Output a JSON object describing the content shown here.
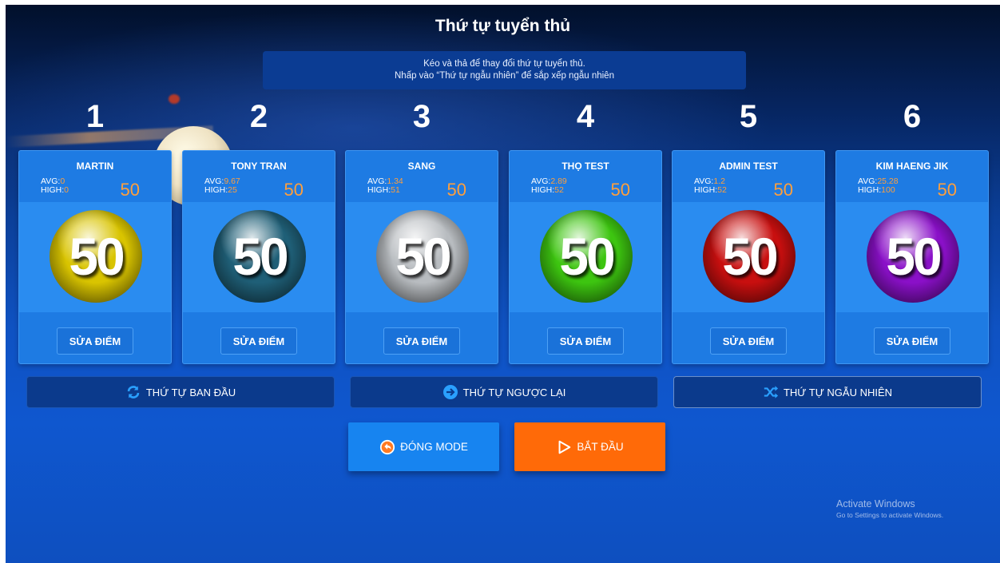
{
  "title": "Thứ tự tuyển thủ",
  "instructions": {
    "line1": "Kéo và thả để thay đổi thứ tự tuyển thủ.",
    "line2": "Nhấp vào “Thứ tự ngẫu nhiên” để sắp xếp ngẫu nhiên"
  },
  "players": [
    {
      "order": "1",
      "name": "MARTIN",
      "avg_label": "AVG:",
      "avg": "0",
      "high_label": "HIGH:",
      "high": "0",
      "score": "50",
      "ball_number": "50",
      "ball_color": "#d9c400",
      "edit_label": "SỬA ĐIỂM"
    },
    {
      "order": "2",
      "name": "TONY TRAN",
      "avg_label": "AVG:",
      "avg": "9.67",
      "high_label": "HIGH:",
      "high": "25",
      "score": "50",
      "ball_number": "50",
      "ball_color": "#1f5f77",
      "edit_label": "SỬA ĐIỂM"
    },
    {
      "order": "3",
      "name": "SANG",
      "avg_label": "AVG:",
      "avg": "1.34",
      "high_label": "HIGH:",
      "high": "51",
      "score": "50",
      "ball_number": "50",
      "ball_color": "#b8bcc0",
      "edit_label": "SỬA ĐIỂM"
    },
    {
      "order": "4",
      "name": "THỌ TEST",
      "avg_label": "AVG:",
      "avg": "2.89",
      "high_label": "HIGH:",
      "high": "52",
      "score": "50",
      "ball_number": "50",
      "ball_color": "#3dc510",
      "edit_label": "SỬA ĐIỂM"
    },
    {
      "order": "5",
      "name": "ADMIN TEST",
      "avg_label": "AVG:",
      "avg": "1.2",
      "high_label": "HIGH:",
      "high": "52",
      "score": "50",
      "ball_number": "50",
      "ball_color": "#c80f0f",
      "edit_label": "SỬA ĐIỂM"
    },
    {
      "order": "6",
      "name": "KIM HAENG JIK",
      "avg_label": "AVG:",
      "avg": "25.28",
      "high_label": "HIGH:",
      "high": "100",
      "score": "50",
      "ball_number": "50",
      "ball_color": "#8a10c8",
      "edit_label": "SỬA ĐIỂM"
    }
  ],
  "order_buttons": {
    "original": {
      "label": "THỨ TỰ BAN ĐẦU",
      "icon": "refresh-icon"
    },
    "reverse": {
      "label": "THỨ TỰ NGƯỢC LẠI",
      "icon": "arrow-right-circle-icon"
    },
    "random": {
      "label": "THỨ TỰ NGẪU NHIÊN",
      "icon": "shuffle-icon"
    }
  },
  "actions": {
    "close": {
      "label": "ĐÓNG MODE",
      "icon": "back-arrow-circle-icon",
      "color": "#1784f0"
    },
    "start": {
      "label": "BẮT ĐẦU",
      "icon": "play-icon",
      "color": "#ff6a08"
    }
  },
  "watermark": {
    "line1": "Activate Windows",
    "line2": "Go to Settings to activate Windows."
  },
  "colors": {
    "accent_orange": "#ff9f3c",
    "card_blue": "#1e7be3",
    "panel_navy": "#0b3a8c"
  }
}
